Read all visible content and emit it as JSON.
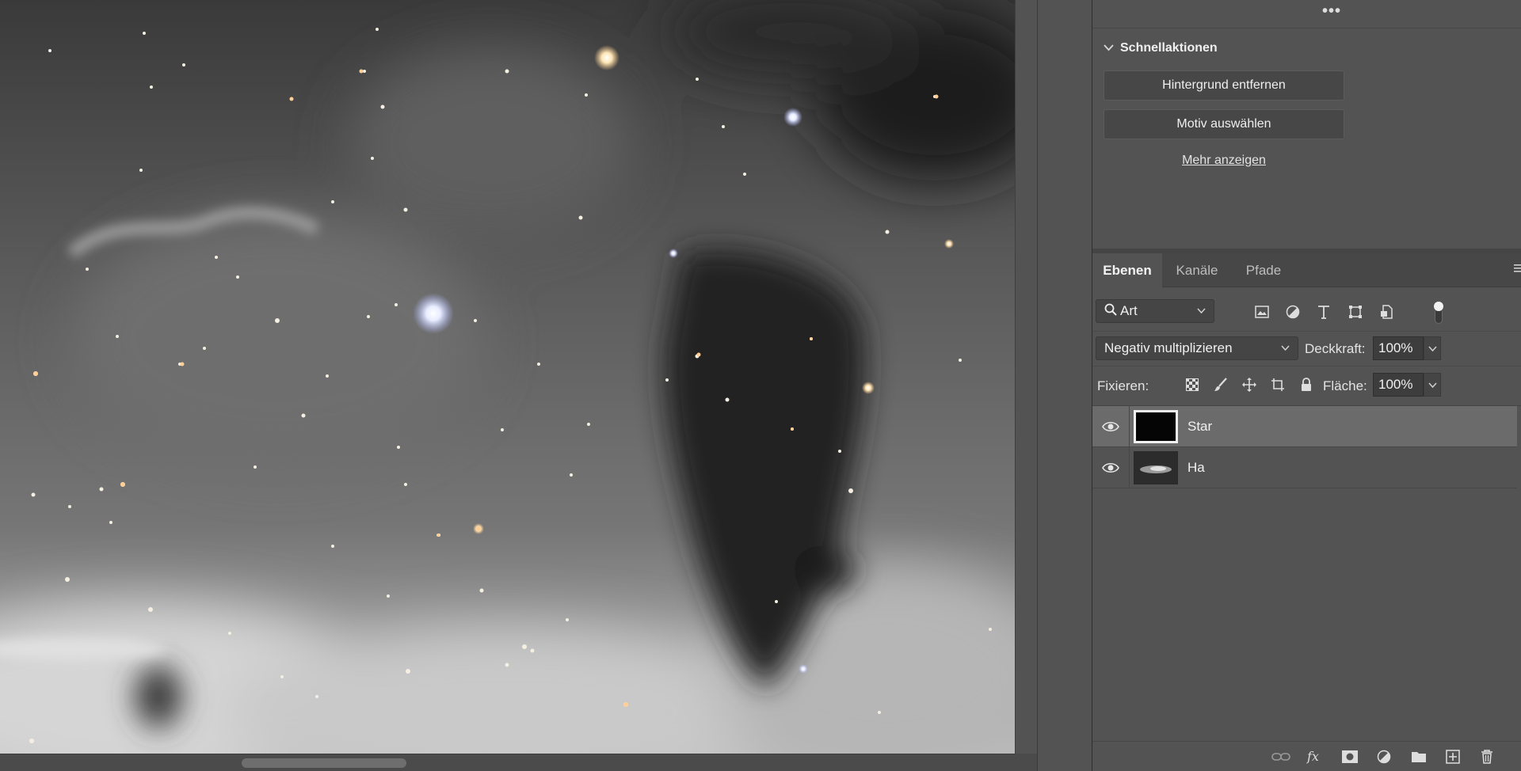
{
  "canvas": {
    "description_icon": "astro-image"
  },
  "properties": {
    "more_label": "•••",
    "quick_actions": {
      "title": "Schnellaktionen",
      "remove_background": "Hintergrund entfernen",
      "select_subject": "Motiv auswählen",
      "show_more": "Mehr anzeigen"
    }
  },
  "layers_panel": {
    "tabs": [
      {
        "label": "Ebenen",
        "active": true
      },
      {
        "label": "Kanäle",
        "active": false
      },
      {
        "label": "Pfade",
        "active": false
      }
    ],
    "filter": {
      "value": "Art",
      "icons": [
        "image-filter-icon",
        "adjustment-filter-icon",
        "type-filter-icon",
        "shape-filter-icon",
        "smartobject-filter-icon"
      ]
    },
    "blend_mode": "Negativ multiplizieren",
    "opacity_label": "Deckkraft:",
    "opacity_value": "100%",
    "lock_label": "Fixieren:",
    "fill_label": "Fläche:",
    "fill_value": "100%",
    "layers": [
      {
        "name": "Star",
        "visible": true,
        "selected": true
      },
      {
        "name": "Ha",
        "visible": true,
        "selected": false
      }
    ]
  },
  "colors": {
    "panel_bg": "#535353",
    "selected_row": "#6b6b6b"
  }
}
